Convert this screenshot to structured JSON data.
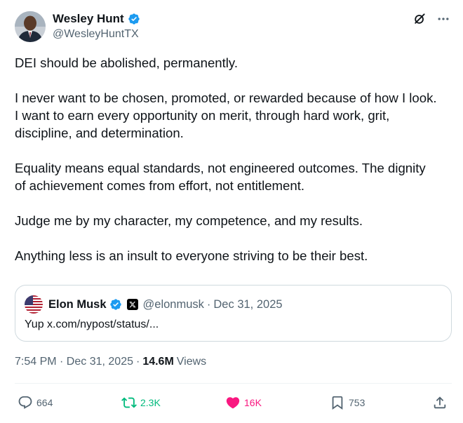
{
  "author": {
    "display_name": "Wesley Hunt",
    "handle": "@WesleyHuntTX",
    "verified": true
  },
  "tweet": {
    "paragraphs": [
      [
        "DEI should be abolished, permanently."
      ],
      [
        "I never want to be chosen, promoted, or rewarded because of how I look.",
        "I want to earn every opportunity on merit, through hard work, grit,",
        "discipline, and determination."
      ],
      [
        "Equality means equal standards, not engineered outcomes. The dignity",
        "of achievement comes from effort, not entitlement."
      ],
      [
        "Judge me by my character, my competence, and my results."
      ],
      [
        "Anything less is an insult to everyone striving to be their best."
      ]
    ]
  },
  "quote": {
    "display_name": "Elon Musk",
    "handle": "@elonmusk",
    "separator": "·",
    "date": "Dec 31, 2025",
    "text": "Yup x.com/nypost/status/..."
  },
  "meta": {
    "timestamp": "7:54 PM · Dec 31, 2025",
    "separator": "·",
    "views_count": "14.6M",
    "views_label": "Views"
  },
  "actions": {
    "replies": "664",
    "reposts": "2.3K",
    "likes": "16K",
    "bookmarks": "753"
  },
  "icons": {
    "verified": "verified-badge-icon",
    "grok": "grok-icon",
    "more": "more-icon",
    "reply": "reply-icon",
    "repost": "repost-icon",
    "like": "heart-icon",
    "bookmark": "bookmark-icon",
    "share": "share-icon"
  },
  "colors": {
    "verified_blue": "#1d9bf0",
    "repost_green": "#00ba7c",
    "like_pink": "#f91880",
    "muted": "#536471"
  }
}
